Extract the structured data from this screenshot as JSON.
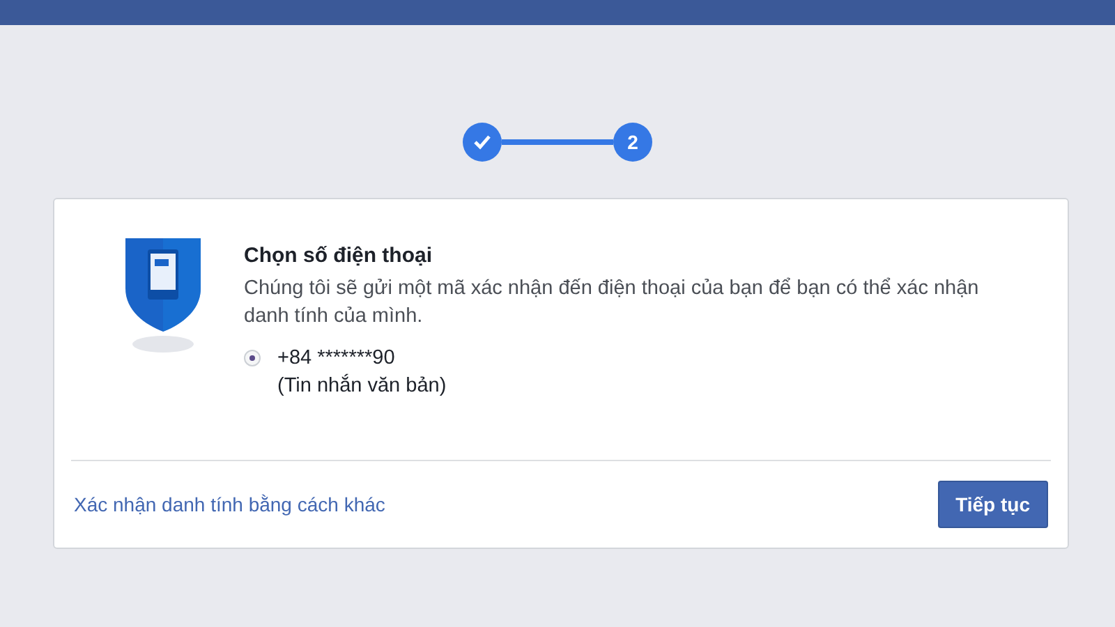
{
  "stepper": {
    "steps": [
      {
        "done": true
      },
      {
        "done": false,
        "label": "2"
      }
    ]
  },
  "card": {
    "title": "Chọn số điện thoại",
    "description": "Chúng tôi sẽ gửi một mã xác nhận đến điện thoại của bạn để bạn có thể xác nhận danh tính của mình.",
    "options": [
      {
        "number": "+84 *******90",
        "note": "(Tin nhắn văn bản)",
        "selected": true
      }
    ],
    "alt_link": "Xác nhận danh tính bằng cách khác",
    "continue_button": "Tiếp tục"
  }
}
